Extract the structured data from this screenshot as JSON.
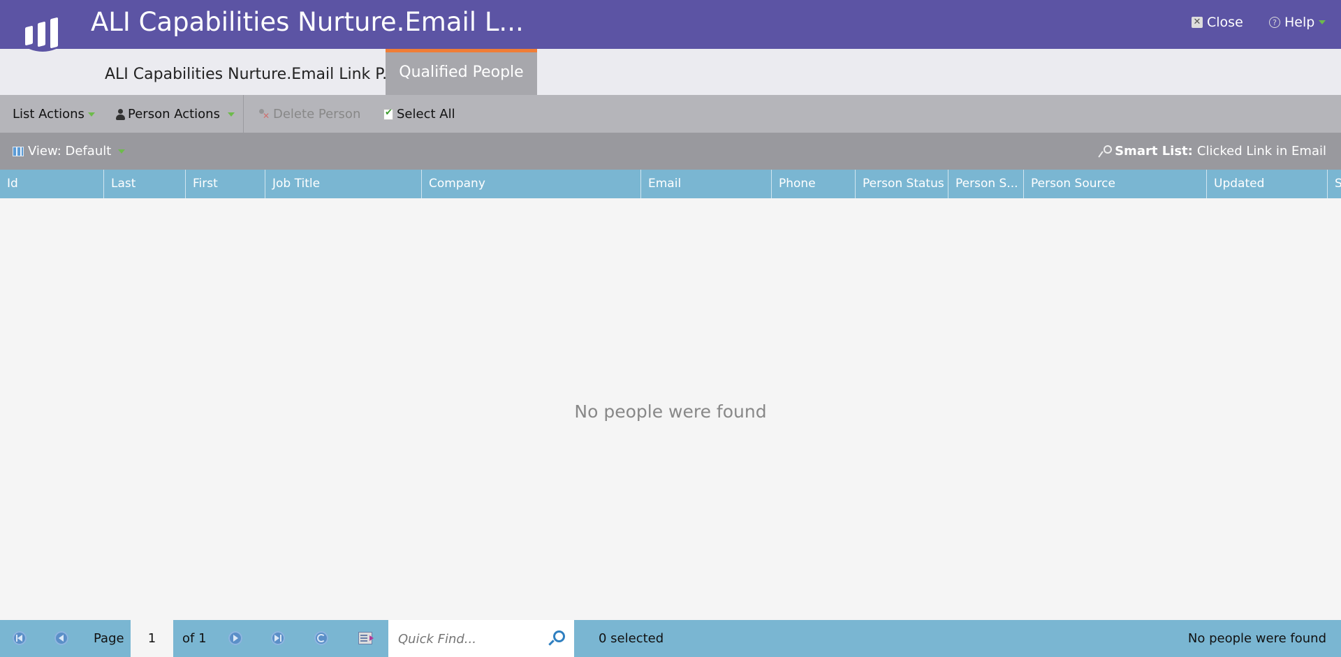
{
  "header": {
    "title": "ALI Capabilities Nurture.Email L...",
    "close_label": "Close",
    "help_label": "Help"
  },
  "tabs": [
    {
      "label": "ALI Capabilities Nurture.Email Link P...",
      "active": false
    },
    {
      "label": "Qualified People",
      "active": true
    }
  ],
  "toolbar": {
    "list_actions": "List Actions",
    "person_actions": "Person Actions",
    "delete_person": "Delete Person",
    "select_all": "Select All"
  },
  "viewbar": {
    "view_label": "View: Default",
    "smart_list_label": "Smart List:",
    "smart_list_value": "Clicked Link in Email"
  },
  "columns": [
    "Id",
    "Last",
    "First",
    "Job Title",
    "Company",
    "Email",
    "Phone",
    "Person Status",
    "Person S...",
    "Person Source",
    "Updated",
    "S"
  ],
  "grid": {
    "empty_message": "No people were found"
  },
  "footer": {
    "page_label": "Page",
    "page_value": "1",
    "of_label": "of 1",
    "quick_find_placeholder": "Quick Find...",
    "selected_text": "0 selected",
    "status_text": "No people were found"
  },
  "colors": {
    "header_bg": "#5c54a4",
    "tab_accent": "#f07d36",
    "grid_header_bg": "#7ab6d2",
    "toolbar_bg": "#b5b5ba",
    "viewbar_bg": "#99999e"
  },
  "icons": [
    "marketo-logo",
    "close-icon",
    "help-icon",
    "person-icon",
    "delete-person-icon",
    "checkbox-icon",
    "grid-view-icon",
    "smart-list-key-icon",
    "first-page-icon",
    "prev-page-icon",
    "next-page-icon",
    "last-page-icon",
    "refresh-icon",
    "column-chooser-icon",
    "search-icon"
  ]
}
